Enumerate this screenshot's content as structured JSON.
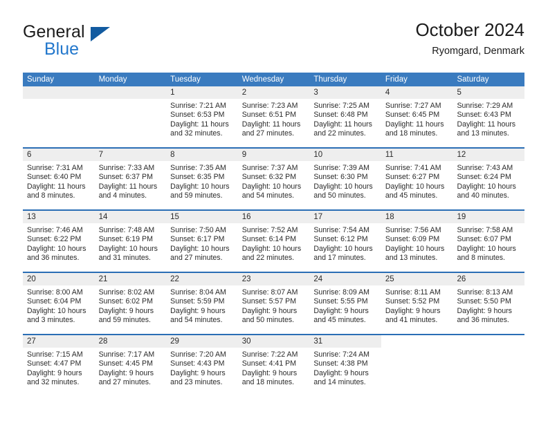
{
  "brand": {
    "word1": "General",
    "word2": "Blue",
    "triangle_color": "#125ba0",
    "blue_color": "#2277cc"
  },
  "header": {
    "title": "October 2024",
    "subtitle": "Ryomgard, Denmark"
  },
  "theme": {
    "header_bar": "#3a7bbf",
    "week_divider": "#2a6eb5",
    "daynum_band": "#eeeeee",
    "text": "#2a2a2a"
  },
  "weekdays": [
    "Sunday",
    "Monday",
    "Tuesday",
    "Wednesday",
    "Thursday",
    "Friday",
    "Saturday"
  ],
  "weeks": [
    [
      {
        "day": "",
        "lines": []
      },
      {
        "day": "",
        "lines": []
      },
      {
        "day": "1",
        "lines": [
          "Sunrise: 7:21 AM",
          "Sunset: 6:53 PM",
          "Daylight: 11 hours",
          "and 32 minutes."
        ]
      },
      {
        "day": "2",
        "lines": [
          "Sunrise: 7:23 AM",
          "Sunset: 6:51 PM",
          "Daylight: 11 hours",
          "and 27 minutes."
        ]
      },
      {
        "day": "3",
        "lines": [
          "Sunrise: 7:25 AM",
          "Sunset: 6:48 PM",
          "Daylight: 11 hours",
          "and 22 minutes."
        ]
      },
      {
        "day": "4",
        "lines": [
          "Sunrise: 7:27 AM",
          "Sunset: 6:45 PM",
          "Daylight: 11 hours",
          "and 18 minutes."
        ]
      },
      {
        "day": "5",
        "lines": [
          "Sunrise: 7:29 AM",
          "Sunset: 6:43 PM",
          "Daylight: 11 hours",
          "and 13 minutes."
        ]
      }
    ],
    [
      {
        "day": "6",
        "lines": [
          "Sunrise: 7:31 AM",
          "Sunset: 6:40 PM",
          "Daylight: 11 hours",
          "and 8 minutes."
        ]
      },
      {
        "day": "7",
        "lines": [
          "Sunrise: 7:33 AM",
          "Sunset: 6:37 PM",
          "Daylight: 11 hours",
          "and 4 minutes."
        ]
      },
      {
        "day": "8",
        "lines": [
          "Sunrise: 7:35 AM",
          "Sunset: 6:35 PM",
          "Daylight: 10 hours",
          "and 59 minutes."
        ]
      },
      {
        "day": "9",
        "lines": [
          "Sunrise: 7:37 AM",
          "Sunset: 6:32 PM",
          "Daylight: 10 hours",
          "and 54 minutes."
        ]
      },
      {
        "day": "10",
        "lines": [
          "Sunrise: 7:39 AM",
          "Sunset: 6:30 PM",
          "Daylight: 10 hours",
          "and 50 minutes."
        ]
      },
      {
        "day": "11",
        "lines": [
          "Sunrise: 7:41 AM",
          "Sunset: 6:27 PM",
          "Daylight: 10 hours",
          "and 45 minutes."
        ]
      },
      {
        "day": "12",
        "lines": [
          "Sunrise: 7:43 AM",
          "Sunset: 6:24 PM",
          "Daylight: 10 hours",
          "and 40 minutes."
        ]
      }
    ],
    [
      {
        "day": "13",
        "lines": [
          "Sunrise: 7:46 AM",
          "Sunset: 6:22 PM",
          "Daylight: 10 hours",
          "and 36 minutes."
        ]
      },
      {
        "day": "14",
        "lines": [
          "Sunrise: 7:48 AM",
          "Sunset: 6:19 PM",
          "Daylight: 10 hours",
          "and 31 minutes."
        ]
      },
      {
        "day": "15",
        "lines": [
          "Sunrise: 7:50 AM",
          "Sunset: 6:17 PM",
          "Daylight: 10 hours",
          "and 27 minutes."
        ]
      },
      {
        "day": "16",
        "lines": [
          "Sunrise: 7:52 AM",
          "Sunset: 6:14 PM",
          "Daylight: 10 hours",
          "and 22 minutes."
        ]
      },
      {
        "day": "17",
        "lines": [
          "Sunrise: 7:54 AM",
          "Sunset: 6:12 PM",
          "Daylight: 10 hours",
          "and 17 minutes."
        ]
      },
      {
        "day": "18",
        "lines": [
          "Sunrise: 7:56 AM",
          "Sunset: 6:09 PM",
          "Daylight: 10 hours",
          "and 13 minutes."
        ]
      },
      {
        "day": "19",
        "lines": [
          "Sunrise: 7:58 AM",
          "Sunset: 6:07 PM",
          "Daylight: 10 hours",
          "and 8 minutes."
        ]
      }
    ],
    [
      {
        "day": "20",
        "lines": [
          "Sunrise: 8:00 AM",
          "Sunset: 6:04 PM",
          "Daylight: 10 hours",
          "and 3 minutes."
        ]
      },
      {
        "day": "21",
        "lines": [
          "Sunrise: 8:02 AM",
          "Sunset: 6:02 PM",
          "Daylight: 9 hours",
          "and 59 minutes."
        ]
      },
      {
        "day": "22",
        "lines": [
          "Sunrise: 8:04 AM",
          "Sunset: 5:59 PM",
          "Daylight: 9 hours",
          "and 54 minutes."
        ]
      },
      {
        "day": "23",
        "lines": [
          "Sunrise: 8:07 AM",
          "Sunset: 5:57 PM",
          "Daylight: 9 hours",
          "and 50 minutes."
        ]
      },
      {
        "day": "24",
        "lines": [
          "Sunrise: 8:09 AM",
          "Sunset: 5:55 PM",
          "Daylight: 9 hours",
          "and 45 minutes."
        ]
      },
      {
        "day": "25",
        "lines": [
          "Sunrise: 8:11 AM",
          "Sunset: 5:52 PM",
          "Daylight: 9 hours",
          "and 41 minutes."
        ]
      },
      {
        "day": "26",
        "lines": [
          "Sunrise: 8:13 AM",
          "Sunset: 5:50 PM",
          "Daylight: 9 hours",
          "and 36 minutes."
        ]
      }
    ],
    [
      {
        "day": "27",
        "lines": [
          "Sunrise: 7:15 AM",
          "Sunset: 4:47 PM",
          "Daylight: 9 hours",
          "and 32 minutes."
        ]
      },
      {
        "day": "28",
        "lines": [
          "Sunrise: 7:17 AM",
          "Sunset: 4:45 PM",
          "Daylight: 9 hours",
          "and 27 minutes."
        ]
      },
      {
        "day": "29",
        "lines": [
          "Sunrise: 7:20 AM",
          "Sunset: 4:43 PM",
          "Daylight: 9 hours",
          "and 23 minutes."
        ]
      },
      {
        "day": "30",
        "lines": [
          "Sunrise: 7:22 AM",
          "Sunset: 4:41 PM",
          "Daylight: 9 hours",
          "and 18 minutes."
        ]
      },
      {
        "day": "31",
        "lines": [
          "Sunrise: 7:24 AM",
          "Sunset: 4:38 PM",
          "Daylight: 9 hours",
          "and 14 minutes."
        ]
      },
      {
        "day": "",
        "lines": [],
        "blank": true
      },
      {
        "day": "",
        "lines": [],
        "blank": true
      }
    ]
  ]
}
